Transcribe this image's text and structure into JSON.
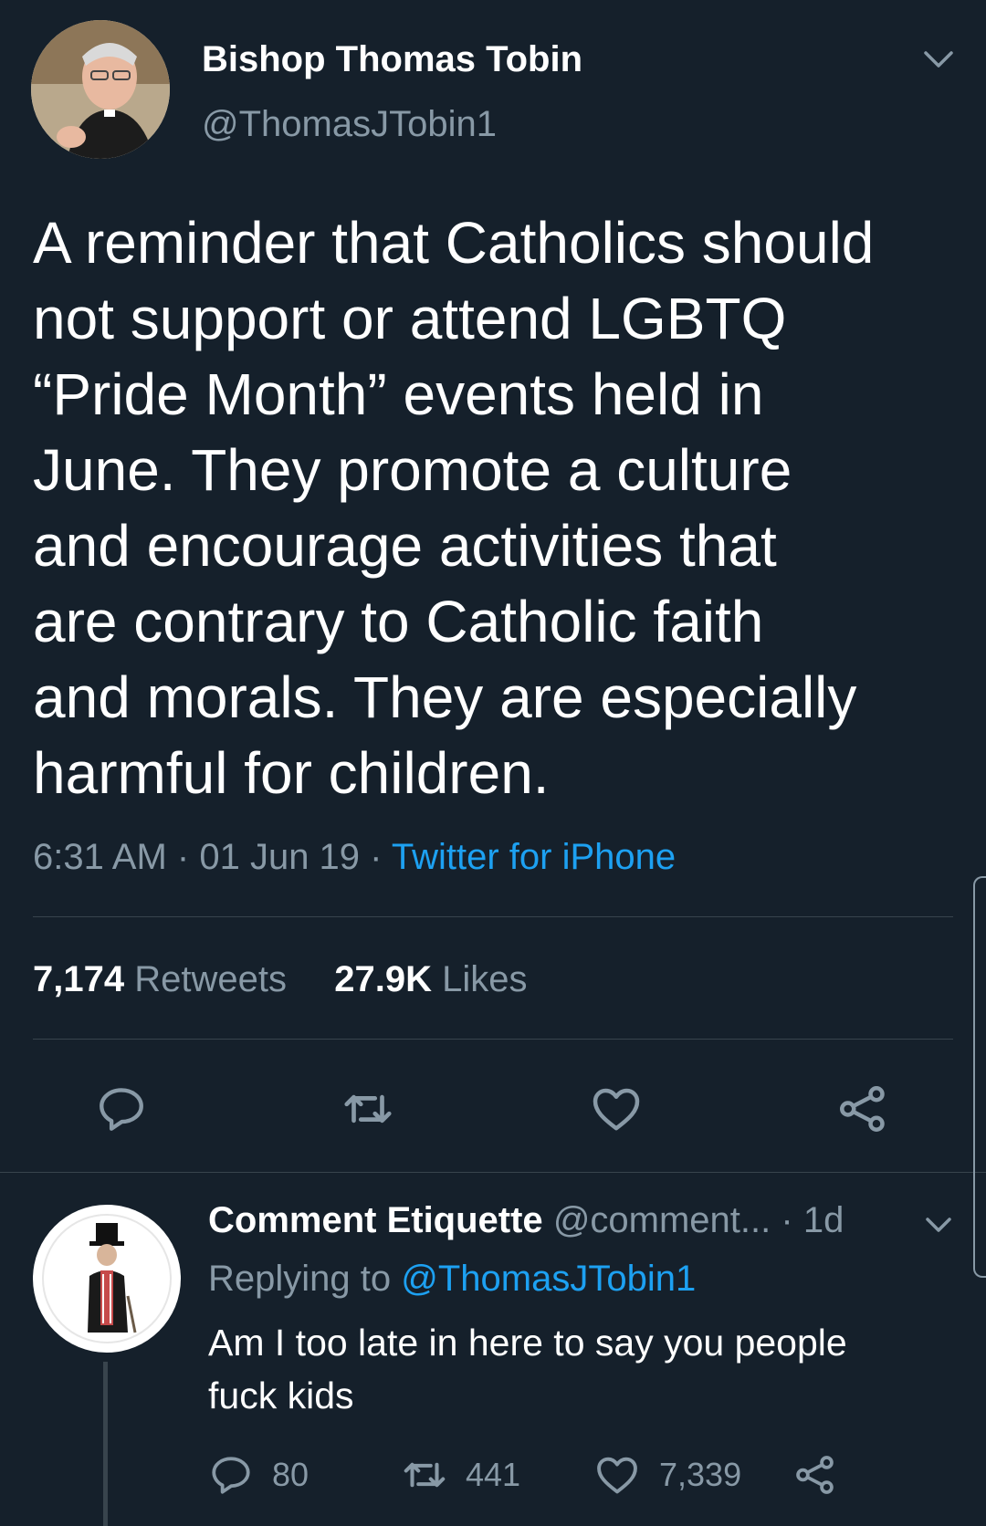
{
  "tweet": {
    "author_name": "Bishop Thomas Tobin",
    "author_handle": "@ThomasJTobin1",
    "text_lines": [
      "A reminder that Catholics should",
      "not support or attend LGBTQ",
      "“Pride Month” events held in",
      "June. They promote a culture",
      "and encourage activities that",
      "are contrary to Catholic faith",
      "and morals. They are especially",
      "harmful for children."
    ],
    "time": "6:31 AM",
    "date": "01 Jun 19",
    "source": "Twitter for iPhone",
    "separator": "·",
    "retweets_count": "7,174",
    "retweets_label": "Retweets",
    "likes_count": "27.9K",
    "likes_label": "Likes"
  },
  "reply": {
    "author_name": "Comment Etiquette",
    "author_handle": "@comment...",
    "time_ago": "1d",
    "separator": "·",
    "replying_prefix": "Replying to",
    "replying_to": "@ThomasJTobin1",
    "text_lines": [
      "Am I too late in here to say you people",
      "fuck kids"
    ],
    "reply_count": "80",
    "retweet_count": "441",
    "like_count": "7,339"
  },
  "colors": {
    "background": "#15202b",
    "muted": "#8899a6",
    "accent": "#1da1f2",
    "divider": "#38444d"
  },
  "icons": [
    "chevron-down-icon",
    "reply-icon",
    "retweet-icon",
    "heart-icon",
    "share-icon"
  ]
}
